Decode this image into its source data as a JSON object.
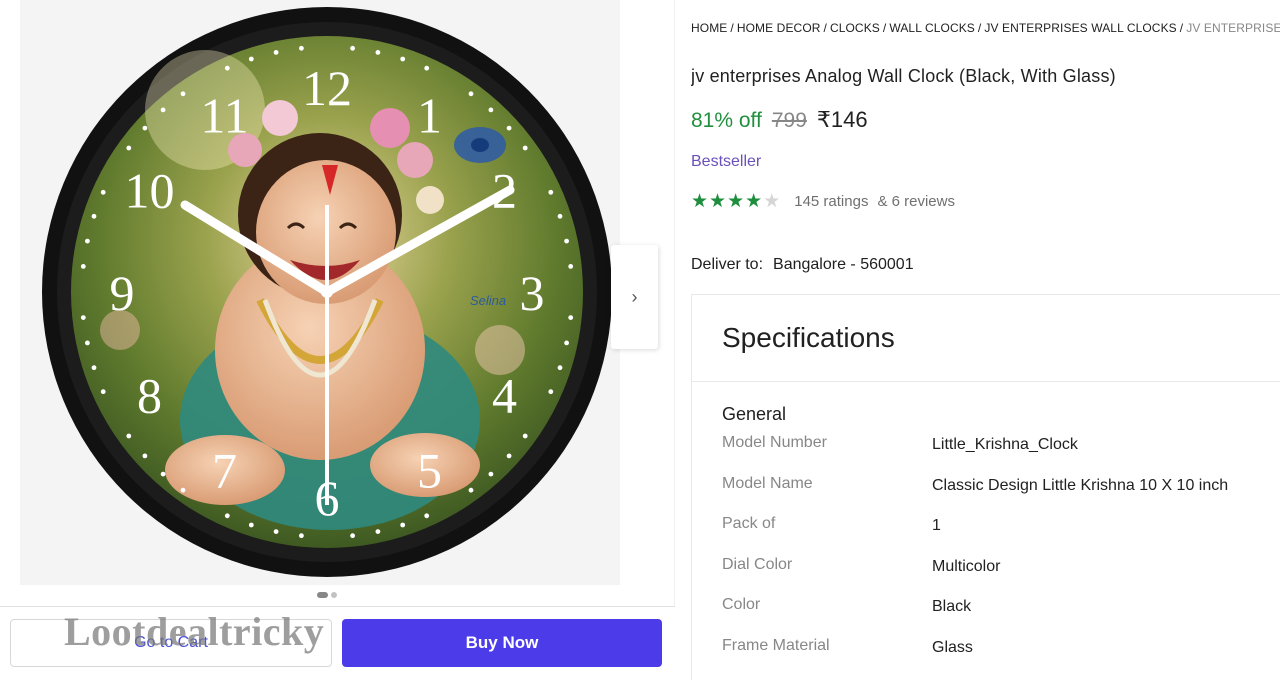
{
  "breadcrumb": [
    {
      "label": "HOME"
    },
    {
      "label": "HOME DECOR"
    },
    {
      "label": "CLOCKS"
    },
    {
      "label": "WALL CLOCKS"
    },
    {
      "label": "JV ENTERPRISES WALL CLOCKS"
    },
    {
      "label": "JV ENTERPRISES A"
    }
  ],
  "product": {
    "title": "jv enterprises Analog Wall Clock  (Black, With Glass)",
    "discount": "81% off",
    "mrp": "799",
    "price": "₹146",
    "badge": "Bestseller",
    "rating_stars": 4,
    "ratings_text": "145 ratings",
    "reviews_text": "& 6 reviews"
  },
  "delivery": {
    "label": "Deliver to:",
    "location": "Bangalore - 560001"
  },
  "gallery": {
    "next_icon": "chevron-right-icon",
    "next_glyph": "›",
    "image_count": 2,
    "active_index": 0
  },
  "clock": {
    "numerals": [
      "12",
      "1",
      "2",
      "3",
      "4",
      "5",
      "6",
      "7",
      "8",
      "9",
      "10",
      "11"
    ],
    "brand_mark": "Selina"
  },
  "actions": {
    "cart_label": "Go to Cart",
    "buy_label": "Buy Now"
  },
  "watermark": "Lootdealtricky",
  "specifications": {
    "title": "Specifications",
    "group": "General",
    "rows": [
      {
        "key": "Model Number",
        "value": "Little_Krishna_Clock"
      },
      {
        "key": "Model Name",
        "value": "Classic Design Little Krishna 10 X 10 inch"
      },
      {
        "key": "Pack of",
        "value": "1"
      },
      {
        "key": "Dial Color",
        "value": "Multicolor"
      },
      {
        "key": "Color",
        "value": "Black"
      },
      {
        "key": "Frame Material",
        "value": "Glass"
      }
    ]
  },
  "colors": {
    "accent": "#4b3be9",
    "discount": "#21903e",
    "badge": "#6b51b8",
    "star": "#1e8e3e"
  }
}
